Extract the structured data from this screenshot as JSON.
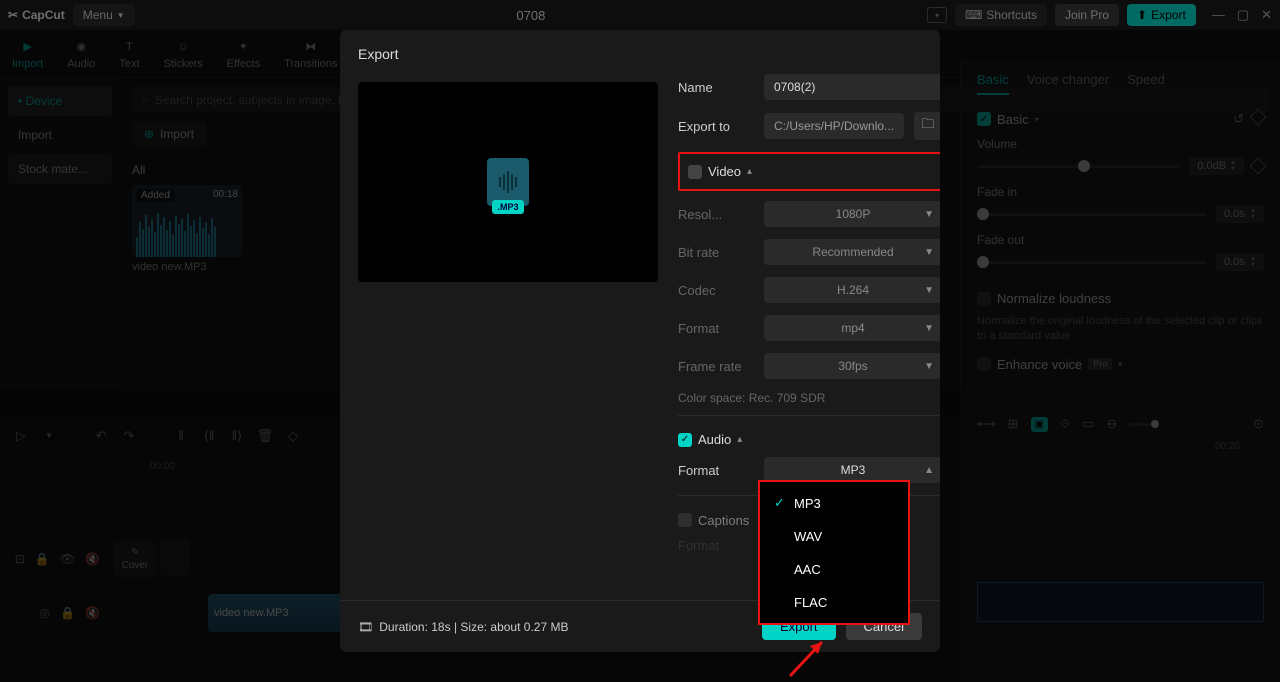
{
  "app": {
    "name": "CapCut",
    "project_title": "0708"
  },
  "titlebar": {
    "menu": "Menu",
    "shortcuts": "Shortcuts",
    "join_pro": "Join Pro",
    "export": "Export"
  },
  "media_tabs": [
    "Import",
    "Audio",
    "Text",
    "Stickers",
    "Effects",
    "Transitions"
  ],
  "media_sidebar": {
    "device": "Device",
    "import": "Import",
    "stock": "Stock mate..."
  },
  "media": {
    "search_placeholder": "Search project, subjects in image, lines",
    "import_btn": "Import",
    "all": "All",
    "thumb": {
      "added": "Added",
      "duration": "00:18",
      "name": "video new.MP3"
    }
  },
  "inspector": {
    "tabs": [
      "Basic",
      "Voice changer",
      "Speed"
    ],
    "basic_label": "Basic",
    "volume": {
      "label": "Volume",
      "value": "0.0dB"
    },
    "fade_in": {
      "label": "Fade in",
      "value": "0.0s"
    },
    "fade_out": {
      "label": "Fade out",
      "value": "0.0s"
    },
    "normalize": {
      "label": "Normalize loudness",
      "desc": "Normalize the original loudness of the selected clip or clips to a standard value"
    },
    "enhance": {
      "label": "Enhance voice",
      "badge": "Pro"
    }
  },
  "timeline": {
    "ruler": [
      "00:00",
      "00:20"
    ],
    "cover": "Cover",
    "clip_name": "video new.MP3"
  },
  "export_modal": {
    "title": "Export",
    "name": {
      "label": "Name",
      "value": "0708(2)"
    },
    "export_to": {
      "label": "Export to",
      "value": "C:/Users/HP/Downlo..."
    },
    "video": {
      "title": "Video",
      "resolution": {
        "label": "Resol...",
        "value": "1080P"
      },
      "bitrate": {
        "label": "Bit rate",
        "value": "Recommended"
      },
      "codec": {
        "label": "Codec",
        "value": "H.264"
      },
      "format": {
        "label": "Format",
        "value": "mp4"
      },
      "framerate": {
        "label": "Frame rate",
        "value": "30fps"
      },
      "colorspace": "Color space: Rec. 709 SDR"
    },
    "audio": {
      "title": "Audio",
      "format": {
        "label": "Format",
        "value": "MP3",
        "options": [
          "MP3",
          "WAV",
          "AAC",
          "FLAC"
        ]
      }
    },
    "captions": {
      "title": "Captions",
      "format_label": "Format"
    },
    "footer": {
      "info": "Duration: 18s | Size: about 0.27 MB",
      "export": "Export",
      "cancel": "Cancel"
    }
  }
}
